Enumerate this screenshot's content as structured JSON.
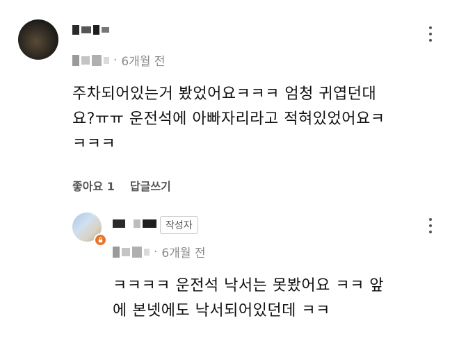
{
  "comment": {
    "time": "6개월 전",
    "text_lines": [
      "주차되어있는거 봤었어요ㅋㅋㅋ 엄청 귀엽던대",
      "요?ㅠㅠ 운전석에 아빠자리라고 적혀있었어요ㅋ",
      "ㅋㅋㅋ"
    ],
    "like_label": "좋아요 1",
    "reply_label": "답글쓰기"
  },
  "reply": {
    "badge": "작성자",
    "time": "6개월 전",
    "text_lines": [
      "ㅋㅋㅋㅋ 운전석 낙서는 못봤어요 ㅋㅋ 앞",
      "에 본넷에도 낙서되어있던데 ㅋㅋ"
    ]
  },
  "colors": {
    "meta_gray": "#8a8a8a",
    "lock_badge": "#e8742a"
  },
  "icons": [
    "more-vert-icon",
    "lock-icon"
  ]
}
